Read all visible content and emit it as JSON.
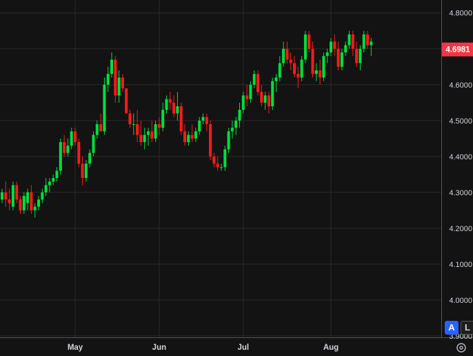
{
  "chart_data": {
    "type": "candlestick",
    "y_axis": {
      "ticks": [
        "4.8000",
        "4.7000",
        "4.6000",
        "4.5000",
        "4.4000",
        "4.3000",
        "4.2000",
        "4.1000",
        "4.0000",
        "3.9000"
      ],
      "ylim": [
        3.896,
        4.836
      ]
    },
    "x_axis": {
      "labels": [
        {
          "label": "May",
          "index": 20
        },
        {
          "label": "Jun",
          "index": 43
        },
        {
          "label": "Jul",
          "index": 66
        },
        {
          "label": "Aug",
          "index": 90
        }
      ],
      "count": 114
    },
    "last_price": "4.6981",
    "colors": {
      "up": "#00e03c",
      "down": "#ff1a1a",
      "price_label_bg": "#f23645",
      "grid": "#2a2a2a",
      "axis_text": "#d1d4dc"
    },
    "candles": [
      [
        4.28,
        4.31,
        4.27,
        4.3
      ],
      [
        4.3,
        4.33,
        4.26,
        4.28
      ],
      [
        4.28,
        4.31,
        4.25,
        4.27
      ],
      [
        4.26,
        4.33,
        4.25,
        4.32
      ],
      [
        4.32,
        4.33,
        4.27,
        4.28
      ],
      [
        4.28,
        4.29,
        4.24,
        4.25
      ],
      [
        4.25,
        4.3,
        4.24,
        4.29
      ],
      [
        4.27,
        4.31,
        4.25,
        4.3
      ],
      [
        4.3,
        4.32,
        4.24,
        4.25
      ],
      [
        4.25,
        4.27,
        4.23,
        4.26
      ],
      [
        4.26,
        4.29,
        4.25,
        4.28
      ],
      [
        4.28,
        4.31,
        4.27,
        4.3
      ],
      [
        4.3,
        4.34,
        4.29,
        4.32
      ],
      [
        4.32,
        4.34,
        4.3,
        4.33
      ],
      [
        4.33,
        4.35,
        4.32,
        4.34
      ],
      [
        4.34,
        4.37,
        4.33,
        4.36
      ],
      [
        4.36,
        4.45,
        4.35,
        4.44
      ],
      [
        4.44,
        4.46,
        4.4,
        4.41
      ],
      [
        4.41,
        4.45,
        4.4,
        4.43
      ],
      [
        4.43,
        4.48,
        4.42,
        4.47
      ],
      [
        4.47,
        4.48,
        4.43,
        4.44
      ],
      [
        4.44,
        4.45,
        4.37,
        4.38
      ],
      [
        4.38,
        4.4,
        4.32,
        4.34
      ],
      [
        4.34,
        4.39,
        4.33,
        4.38
      ],
      [
        4.38,
        4.42,
        4.37,
        4.41
      ],
      [
        4.41,
        4.47,
        4.4,
        4.46
      ],
      [
        4.46,
        4.5,
        4.45,
        4.49
      ],
      [
        4.49,
        4.52,
        4.47,
        4.47
      ],
      [
        4.47,
        4.62,
        4.46,
        4.6
      ],
      [
        4.6,
        4.65,
        4.58,
        4.63
      ],
      [
        4.63,
        4.69,
        4.62,
        4.67
      ],
      [
        4.67,
        4.68,
        4.55,
        4.57
      ],
      [
        4.57,
        4.64,
        4.55,
        4.62
      ],
      [
        4.62,
        4.63,
        4.58,
        4.59
      ],
      [
        4.59,
        4.59,
        4.53,
        4.52
      ],
      [
        4.52,
        4.53,
        4.48,
        4.49
      ],
      [
        4.49,
        4.52,
        4.46,
        4.49
      ],
      [
        4.49,
        4.53,
        4.44,
        4.46
      ],
      [
        4.46,
        4.5,
        4.43,
        4.44
      ],
      [
        4.44,
        4.48,
        4.42,
        4.46
      ],
      [
        4.46,
        4.48,
        4.43,
        4.47
      ],
      [
        4.47,
        4.5,
        4.44,
        4.45
      ],
      [
        4.45,
        4.5,
        4.44,
        4.49
      ],
      [
        4.49,
        4.51,
        4.46,
        4.48
      ],
      [
        4.48,
        4.55,
        4.47,
        4.53
      ],
      [
        4.53,
        4.57,
        4.52,
        4.56
      ],
      [
        4.56,
        4.58,
        4.53,
        4.55
      ],
      [
        4.55,
        4.57,
        4.51,
        4.52
      ],
      [
        4.52,
        4.58,
        4.5,
        4.54
      ],
      [
        4.54,
        4.55,
        4.46,
        4.47
      ],
      [
        4.47,
        4.49,
        4.43,
        4.44
      ],
      [
        4.44,
        4.47,
        4.43,
        4.46
      ],
      [
        4.46,
        4.49,
        4.44,
        4.45
      ],
      [
        4.45,
        4.48,
        4.44,
        4.47
      ],
      [
        4.47,
        4.51,
        4.46,
        4.5
      ],
      [
        4.5,
        4.52,
        4.49,
        4.51
      ],
      [
        4.51,
        4.52,
        4.47,
        4.49
      ],
      [
        4.49,
        4.5,
        4.39,
        4.4
      ],
      [
        4.4,
        4.41,
        4.37,
        4.38
      ],
      [
        4.38,
        4.4,
        4.36,
        4.37
      ],
      [
        4.37,
        4.38,
        4.36,
        4.37
      ],
      [
        4.37,
        4.43,
        4.36,
        4.42
      ],
      [
        4.42,
        4.48,
        4.41,
        4.47
      ],
      [
        4.47,
        4.5,
        4.45,
        4.48
      ],
      [
        4.48,
        4.51,
        4.46,
        4.5
      ],
      [
        4.5,
        4.55,
        4.48,
        4.53
      ],
      [
        4.53,
        4.58,
        4.52,
        4.57
      ],
      [
        4.57,
        4.6,
        4.54,
        4.56
      ],
      [
        4.56,
        4.61,
        4.55,
        4.6
      ],
      [
        4.6,
        4.64,
        4.59,
        4.63
      ],
      [
        4.63,
        4.64,
        4.57,
        4.58
      ],
      [
        4.58,
        4.6,
        4.54,
        4.55
      ],
      [
        4.55,
        4.58,
        4.53,
        4.57
      ],
      [
        4.57,
        4.58,
        4.52,
        4.54
      ],
      [
        4.54,
        4.62,
        4.53,
        4.61
      ],
      [
        4.61,
        4.63,
        4.58,
        4.62
      ],
      [
        4.62,
        4.68,
        4.61,
        4.66
      ],
      [
        4.66,
        4.72,
        4.65,
        4.7
      ],
      [
        4.7,
        4.72,
        4.66,
        4.67
      ],
      [
        4.67,
        4.69,
        4.64,
        4.66
      ],
      [
        4.66,
        4.68,
        4.62,
        4.63
      ],
      [
        4.63,
        4.65,
        4.59,
        4.62
      ],
      [
        4.62,
        4.68,
        4.61,
        4.67
      ],
      [
        4.67,
        4.75,
        4.66,
        4.74
      ],
      [
        4.74,
        4.75,
        4.69,
        4.7
      ],
      [
        4.7,
        4.72,
        4.62,
        4.63
      ],
      [
        4.63,
        4.66,
        4.61,
        4.64
      ],
      [
        4.64,
        4.67,
        4.6,
        4.62
      ],
      [
        4.62,
        4.69,
        4.61,
        4.68
      ],
      [
        4.68,
        4.7,
        4.66,
        4.69
      ],
      [
        4.69,
        4.73,
        4.68,
        4.72
      ],
      [
        4.72,
        4.74,
        4.68,
        4.7
      ],
      [
        4.7,
        4.72,
        4.64,
        4.65
      ],
      [
        4.65,
        4.7,
        4.64,
        4.69
      ],
      [
        4.69,
        4.72,
        4.68,
        4.71
      ],
      [
        4.71,
        4.75,
        4.7,
        4.74
      ],
      [
        4.74,
        4.75,
        4.68,
        4.7
      ],
      [
        4.7,
        4.72,
        4.65,
        4.66
      ],
      [
        4.66,
        4.71,
        4.64,
        4.7
      ],
      [
        4.7,
        4.75,
        4.69,
        4.74
      ],
      [
        4.74,
        4.75,
        4.7,
        4.71
      ],
      [
        4.71,
        4.73,
        4.68,
        4.72
      ]
    ]
  },
  "controls": {
    "auto_label": "A",
    "log_label": "L"
  },
  "icons": {
    "settings": "settings-icon"
  }
}
